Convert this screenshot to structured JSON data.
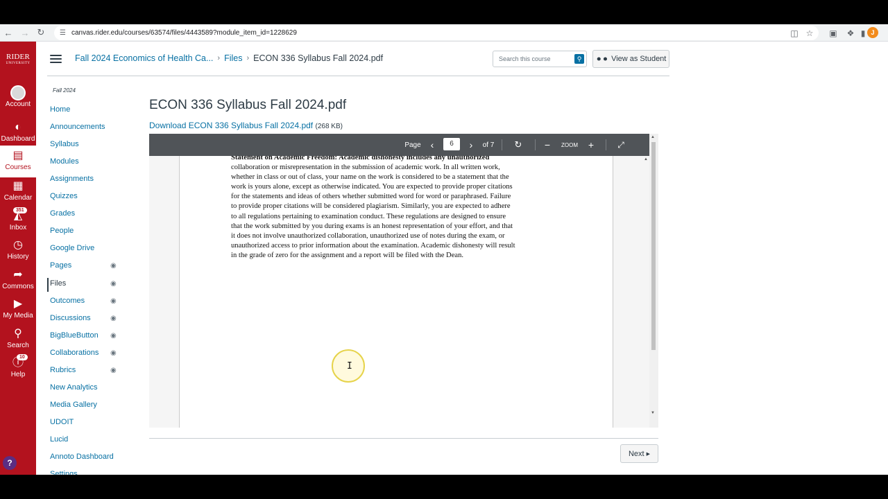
{
  "browser": {
    "url": "canvas.rider.edu/courses/63574/files/4443589?module_item_id=1228629",
    "profile_initial": "J"
  },
  "global_nav": {
    "logo_text": "RIDER",
    "logo_sub": "UNIVERSITY",
    "items": [
      {
        "label": "Account",
        "icon": "account-avatar"
      },
      {
        "label": "Dashboard",
        "icon": "dashboard-icon"
      },
      {
        "label": "Courses",
        "icon": "courses-icon"
      },
      {
        "label": "Calendar",
        "icon": "calendar-icon"
      },
      {
        "label": "Inbox",
        "icon": "inbox-icon",
        "badge": "351"
      },
      {
        "label": "History",
        "icon": "history-icon"
      },
      {
        "label": "Commons",
        "icon": "commons-icon"
      },
      {
        "label": "My Media",
        "icon": "media-icon"
      },
      {
        "label": "Search",
        "icon": "search-icon"
      },
      {
        "label": "Help",
        "icon": "help-icon",
        "badge": "10"
      }
    ],
    "active": "Courses",
    "help_fab": "?"
  },
  "header": {
    "breadcrumb": [
      "Fall 2024 Economics of Health Ca...",
      "Files",
      "ECON 336 Syllabus Fall 2024.pdf"
    ],
    "search_placeholder": "Search this course",
    "view_as_student": "View as Student"
  },
  "course_nav": {
    "term": "Fall 2024",
    "items": [
      {
        "label": "Home"
      },
      {
        "label": "Announcements"
      },
      {
        "label": "Syllabus"
      },
      {
        "label": "Modules"
      },
      {
        "label": "Assignments"
      },
      {
        "label": "Quizzes"
      },
      {
        "label": "Grades"
      },
      {
        "label": "People"
      },
      {
        "label": "Google Drive"
      },
      {
        "label": "Pages",
        "hidden": true
      },
      {
        "label": "Files",
        "hidden": true
      },
      {
        "label": "Outcomes",
        "hidden": true
      },
      {
        "label": "Discussions",
        "hidden": true
      },
      {
        "label": "BigBlueButton",
        "hidden": true
      },
      {
        "label": "Collaborations",
        "hidden": true
      },
      {
        "label": "Rubrics",
        "hidden": true
      },
      {
        "label": "New Analytics"
      },
      {
        "label": "Media Gallery"
      },
      {
        "label": "UDOIT"
      },
      {
        "label": "Lucid"
      },
      {
        "label": "Annoto Dashboard"
      },
      {
        "label": "Settings"
      }
    ],
    "active": "Files"
  },
  "content": {
    "title": "ECON 336 Syllabus Fall 2024.pdf",
    "download_label": "Download ECON 336 Syllabus Fall 2024.pdf",
    "file_size": "(268 KB)",
    "next_label": "Next"
  },
  "pdf_viewer": {
    "page_label": "Page",
    "current_page": "6",
    "total_pages": "of 7",
    "zoom_label": "ZOOM",
    "text_lines": [
      "Statement on Academic Freedom: Academic dishonesty includes any unauthorized",
      "collaboration or misrepresentation in the submission of academic work. In all written work,",
      "whether in class or out of class, your name on the work is considered to be a statement that the",
      "work is yours alone, except as otherwise indicated. You are expected to provide proper citations",
      "for the statements and ideas of others whether submitted word for word or paraphrased. Failure",
      "to provide proper citations will be considered plagiarism. Similarly, you are expected to adhere",
      "to all regulations pertaining to examination conduct. These regulations are designed to ensure",
      "that the work submitted by you during exams is an honest representation of your effort, and that",
      "it does not involve unauthorized collaboration, unauthorized use of notes during the exam, or",
      "unauthorized access to prior information about the examination. Academic dishonesty will result",
      "in the grade of zero for the assignment and a report will be filed with the Dean."
    ]
  },
  "colors": {
    "brand": "#b3121e",
    "link": "#0770a3",
    "text": "#2d3b45",
    "pdf_toolbar": "#505458"
  }
}
